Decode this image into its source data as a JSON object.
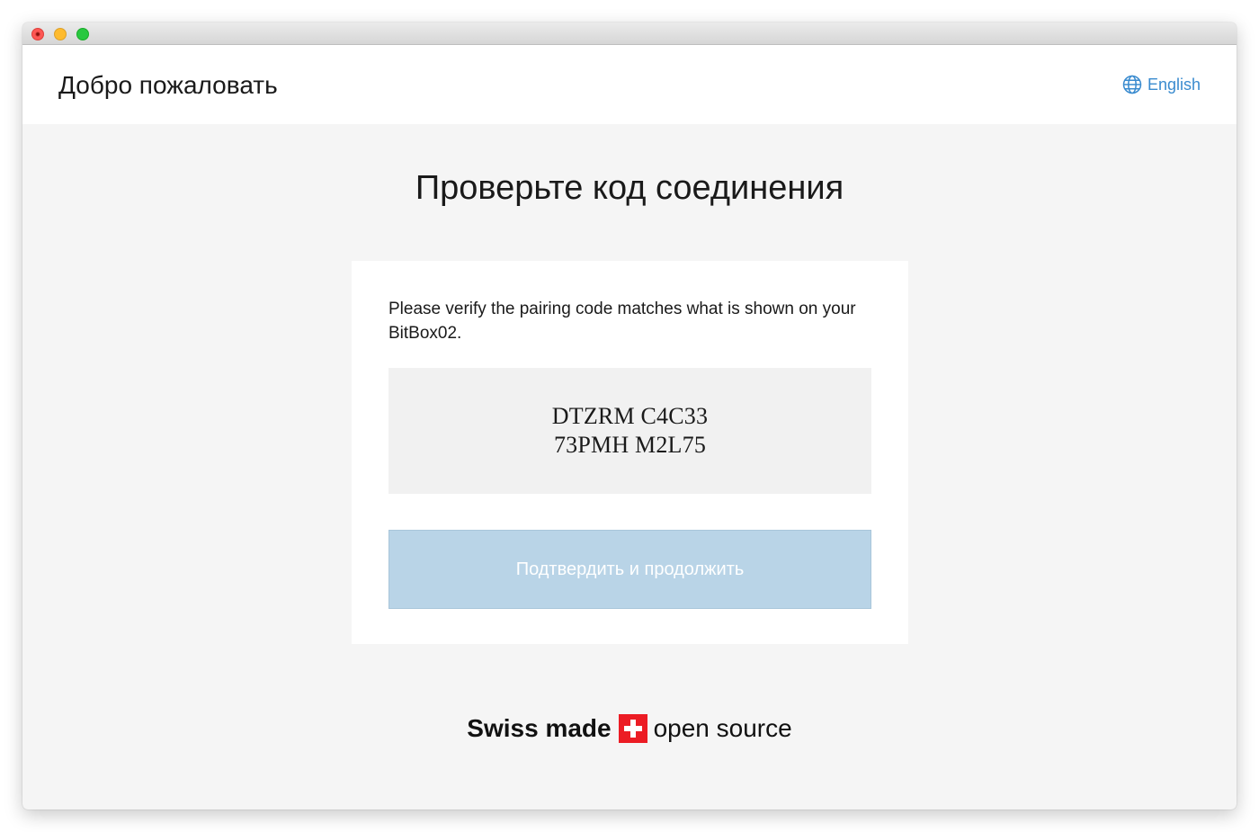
{
  "window": {
    "controls": [
      "close-button",
      "minimize-button",
      "zoom-button"
    ]
  },
  "header": {
    "title": "Добро пожаловать",
    "language": {
      "label": "English",
      "icon": "globe-icon"
    }
  },
  "main": {
    "title": "Проверьте код соединения",
    "description": "Please verify the pairing code matches what is shown on your BitBox02.",
    "pairing_code": {
      "line1": "DTZRM C4C33",
      "line2": "73PMH M2L75"
    },
    "confirm_label": "Подтвердить и продолжить"
  },
  "footer": {
    "swiss_made": "Swiss made",
    "open_source": "open source",
    "flag_icon": "swiss-flag-icon"
  },
  "colors": {
    "accent": "#3a8bcf",
    "button_disabled": "#b9d4e7",
    "flag_red": "#ec1c24",
    "background": "#f5f5f5"
  }
}
